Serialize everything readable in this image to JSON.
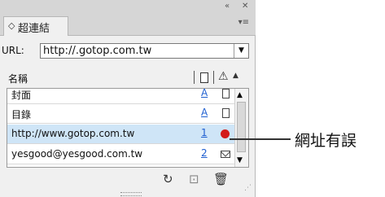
{
  "panel": {
    "collapse_glyph": "«",
    "close_glyph": "✕",
    "tab": {
      "chevron": "◇",
      "label": "超連結"
    },
    "menu_glyph": "▾≡",
    "url": {
      "label": "URL:",
      "value": "http://.gotop.com.tw",
      "dropdown_glyph": "▼"
    },
    "columns": {
      "name": "名稱",
      "sort_glyph": "▲"
    },
    "rows": [
      {
        "label": "封面",
        "page": "A",
        "status_icon": "document-icon"
      },
      {
        "label": "目錄",
        "page": "A",
        "status_icon": "document-icon"
      },
      {
        "label": "http://www.gotop.com.tw",
        "page": "1",
        "status_icon": "error-dot-icon",
        "selected": true
      },
      {
        "label": "yesgood@yesgood.com.tw",
        "page": "2",
        "status_icon": "mail-icon"
      }
    ],
    "toolbar": {
      "refresh_glyph": "↻",
      "new_glyph": "⊡",
      "delete_glyph": "🗑"
    }
  },
  "callout": {
    "text": "網址有誤"
  },
  "colors": {
    "selection": "#cfe5f7",
    "error": "#d31b1b",
    "link": "#1f5fd0"
  }
}
